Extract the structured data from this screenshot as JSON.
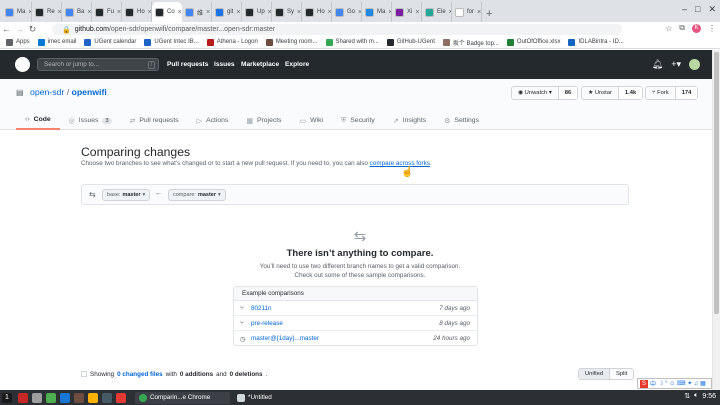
{
  "browser": {
    "tabs": [
      {
        "title": "Ma",
        "color": "#4285f4",
        "active": false
      },
      {
        "title": "Re",
        "color": "#24292e",
        "active": false
      },
      {
        "title": "Ba",
        "color": "#4285f4",
        "active": false
      },
      {
        "title": "Fu",
        "color": "#24292e",
        "active": false
      },
      {
        "title": "Ho",
        "color": "#24292e",
        "active": false
      },
      {
        "title": "Co",
        "color": "#24292e",
        "active": true
      },
      {
        "title": "维",
        "color": "#4285f4",
        "active": false
      },
      {
        "title": "git",
        "color": "#1a73e8",
        "active": false
      },
      {
        "title": "Up",
        "color": "#24292e",
        "active": false
      },
      {
        "title": "Sy",
        "color": "#24292e",
        "active": false
      },
      {
        "title": "Ho",
        "color": "#24292e",
        "active": false
      },
      {
        "title": "Go",
        "color": "#4285f4",
        "active": false
      },
      {
        "title": "Ma",
        "color": "#1e88e5",
        "active": false
      },
      {
        "title": "Xi",
        "color": "#7b1fa2",
        "active": false
      },
      {
        "title": "Ele",
        "color": "#26a69a",
        "active": false
      },
      {
        "title": "for",
        "color": "#ffffff",
        "active": false
      }
    ],
    "tab_close": "×",
    "new_tab": "+",
    "window_controls": {
      "minimize": "–",
      "maximize": "□",
      "close": "✕"
    },
    "url": {
      "host": "github.com",
      "path": "/open-sdr/openwifi/compare/master...open-sdr:master"
    },
    "profile_initial": "K",
    "bookmarks": [
      {
        "label": "Apps",
        "color": "#5f6368"
      },
      {
        "label": "imec email",
        "color": "#0078d4"
      },
      {
        "label": "UGent calendar",
        "color": "#1e64c8"
      },
      {
        "label": "UGent Intec IB...",
        "color": "#1e64c8"
      },
      {
        "label": "Athena - Logon",
        "color": "#b71c1c"
      },
      {
        "label": "Meeting room...",
        "color": "#6d4c41"
      },
      {
        "label": "Shared with m...",
        "color": "#34a853"
      },
      {
        "label": "GitHub-UGent",
        "color": "#24292e"
      },
      {
        "label": "坂个 Badge top...",
        "color": "#8d6e63"
      },
      {
        "label": "OutOfOffice.xlsx",
        "color": "#1e7e34"
      },
      {
        "label": "IDLABintra - ID...",
        "color": "#1565c0"
      }
    ]
  },
  "github": {
    "search_placeholder": "Search or jump to...",
    "search_key": "/",
    "nav": [
      "Pull requests",
      "Issues",
      "Marketplace",
      "Explore"
    ],
    "repo": {
      "owner": "open-sdr",
      "separator": "/",
      "name": "openwifi"
    },
    "buttons": {
      "watch": {
        "label": "Unwatch ▾",
        "count": "86"
      },
      "star": {
        "label": "Unstar",
        "count": "1.4k"
      },
      "fork": {
        "label": "Fork",
        "count": "174"
      }
    },
    "repo_tabs": [
      {
        "icon": "‹›",
        "label": "Code",
        "selected": true
      },
      {
        "icon": "◎",
        "label": "Issues",
        "badge": "3"
      },
      {
        "icon": "⇄",
        "label": "Pull requests"
      },
      {
        "icon": "▷",
        "label": "Actions"
      },
      {
        "icon": "▦",
        "label": "Projects"
      },
      {
        "icon": "▭",
        "label": "Wiki"
      },
      {
        "icon": "⛨",
        "label": "Security"
      },
      {
        "icon": "↗",
        "label": "Insights"
      },
      {
        "icon": "⚙",
        "label": "Settings"
      }
    ]
  },
  "compare": {
    "title": "Comparing changes",
    "description": "Choose two branches to see what’s changed or to start a new pull request. If you need to, you can also",
    "link": "compare across forks",
    "description_end": ".",
    "base_label": "base:",
    "base_value": "master",
    "compare_label": "compare:",
    "compare_value": "master",
    "arrow": "←",
    "blank_heading": "There isn’t anything to compare.",
    "blank_line1": "You’ll need to use two different branch names to get a valid comparison.",
    "blank_line2": "Check out some of these sample comparisons.",
    "examples_header": "Example comparisons",
    "examples": [
      {
        "name": "80211n",
        "time": "7 days ago"
      },
      {
        "name": "pre-release",
        "time": "8 days ago"
      },
      {
        "name": "master@{1day}...master",
        "time": "24 hours ago"
      }
    ],
    "status": {
      "prefix": "Showing",
      "changed": "0 changed files",
      "with": "with",
      "additions": "0 additions",
      "and": "and",
      "deletions": "0 deletions",
      "end": "."
    },
    "view_unified": "Unified",
    "view_split": "Split"
  },
  "taskbar": {
    "items": [
      {
        "color": "#c62828"
      },
      {
        "color": "#9e9e9e"
      },
      {
        "color": "#4caf50"
      },
      {
        "color": "#1976d2"
      },
      {
        "color": "#6d4c41"
      },
      {
        "color": "#ffb300"
      },
      {
        "color": "#455a64"
      },
      {
        "color": "#e53935"
      }
    ],
    "workspace": "1",
    "chrome_label": "Comparin...e Chrome",
    "editor_label": "*Untitled",
    "time": "9:56",
    "ime": "中"
  }
}
